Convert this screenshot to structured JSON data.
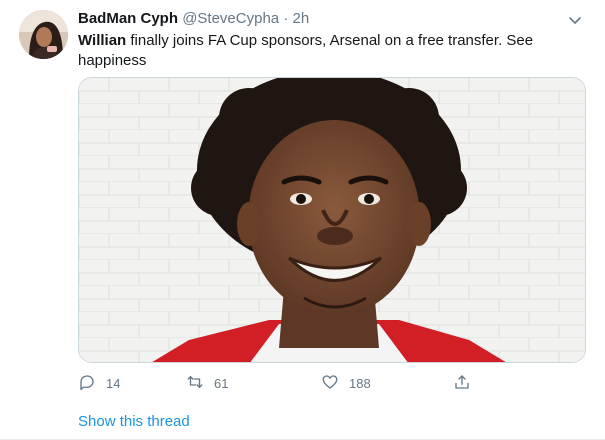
{
  "tweet": {
    "author": {
      "display_name": "BadMan Cyph",
      "handle": "@SteveCypha",
      "avatar_icon": "user-avatar"
    },
    "separator": "·",
    "timestamp": "2h",
    "menu_icon": "chevron-down-icon",
    "text": {
      "mention": "Willian",
      "body": " finally joins FA Cup sponsors, Arsenal on a free transfer. See happiness"
    },
    "media": {
      "description_icon": "photo-smiling-man"
    },
    "actions": {
      "reply": {
        "icon": "reply-icon",
        "count": "14"
      },
      "retweet": {
        "icon": "retweet-icon",
        "count": "61"
      },
      "like": {
        "icon": "heart-icon",
        "count": "188"
      },
      "share": {
        "icon": "share-icon"
      }
    },
    "show_thread_label": "Show this thread"
  },
  "colors": {
    "text_primary": "#14171a",
    "text_secondary": "#657786",
    "link": "#1b95e0",
    "border": "#ccd6dd",
    "shirt_red": "#d21f26"
  }
}
